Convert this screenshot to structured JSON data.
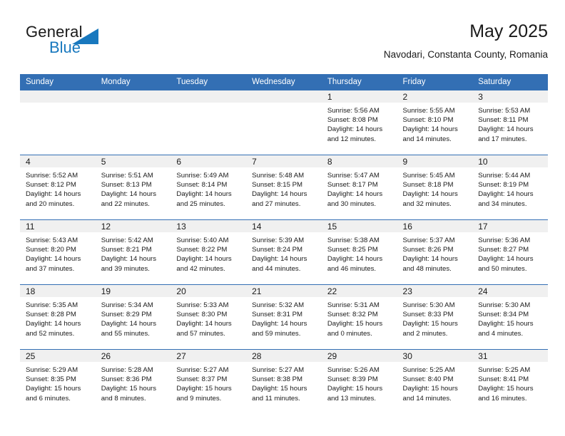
{
  "brand": {
    "name_part1": "General",
    "name_part2": "Blue",
    "triangle_color": "#1878be",
    "icon": "triangle-logo-icon"
  },
  "header": {
    "title": "May 2025",
    "subtitle": "Navodari, Constanta County, Romania",
    "accent_color": "#336fb4",
    "daynum_band_color": "#f0f0f0"
  },
  "weekday_headers": [
    "Sunday",
    "Monday",
    "Tuesday",
    "Wednesday",
    "Thursday",
    "Friday",
    "Saturday"
  ],
  "labels": {
    "sunrise_prefix": "Sunrise:",
    "sunset_prefix": "Sunset:",
    "daylight_prefix": "Daylight:"
  },
  "weeks": [
    [
      {
        "day": "",
        "sunrise": "",
        "sunset": "",
        "daylight_line1": "",
        "daylight_line2": "",
        "empty": true
      },
      {
        "day": "",
        "sunrise": "",
        "sunset": "",
        "daylight_line1": "",
        "daylight_line2": "",
        "empty": true
      },
      {
        "day": "",
        "sunrise": "",
        "sunset": "",
        "daylight_line1": "",
        "daylight_line2": "",
        "empty": true
      },
      {
        "day": "",
        "sunrise": "",
        "sunset": "",
        "daylight_line1": "",
        "daylight_line2": "",
        "empty": true
      },
      {
        "day": "1",
        "sunrise": "Sunrise: 5:56 AM",
        "sunset": "Sunset: 8:08 PM",
        "daylight_line1": "Daylight: 14 hours",
        "daylight_line2": "and 12 minutes.",
        "empty": false
      },
      {
        "day": "2",
        "sunrise": "Sunrise: 5:55 AM",
        "sunset": "Sunset: 8:10 PM",
        "daylight_line1": "Daylight: 14 hours",
        "daylight_line2": "and 14 minutes.",
        "empty": false
      },
      {
        "day": "3",
        "sunrise": "Sunrise: 5:53 AM",
        "sunset": "Sunset: 8:11 PM",
        "daylight_line1": "Daylight: 14 hours",
        "daylight_line2": "and 17 minutes.",
        "empty": false
      }
    ],
    [
      {
        "day": "4",
        "sunrise": "Sunrise: 5:52 AM",
        "sunset": "Sunset: 8:12 PM",
        "daylight_line1": "Daylight: 14 hours",
        "daylight_line2": "and 20 minutes.",
        "empty": false
      },
      {
        "day": "5",
        "sunrise": "Sunrise: 5:51 AM",
        "sunset": "Sunset: 8:13 PM",
        "daylight_line1": "Daylight: 14 hours",
        "daylight_line2": "and 22 minutes.",
        "empty": false
      },
      {
        "day": "6",
        "sunrise": "Sunrise: 5:49 AM",
        "sunset": "Sunset: 8:14 PM",
        "daylight_line1": "Daylight: 14 hours",
        "daylight_line2": "and 25 minutes.",
        "empty": false
      },
      {
        "day": "7",
        "sunrise": "Sunrise: 5:48 AM",
        "sunset": "Sunset: 8:15 PM",
        "daylight_line1": "Daylight: 14 hours",
        "daylight_line2": "and 27 minutes.",
        "empty": false
      },
      {
        "day": "8",
        "sunrise": "Sunrise: 5:47 AM",
        "sunset": "Sunset: 8:17 PM",
        "daylight_line1": "Daylight: 14 hours",
        "daylight_line2": "and 30 minutes.",
        "empty": false
      },
      {
        "day": "9",
        "sunrise": "Sunrise: 5:45 AM",
        "sunset": "Sunset: 8:18 PM",
        "daylight_line1": "Daylight: 14 hours",
        "daylight_line2": "and 32 minutes.",
        "empty": false
      },
      {
        "day": "10",
        "sunrise": "Sunrise: 5:44 AM",
        "sunset": "Sunset: 8:19 PM",
        "daylight_line1": "Daylight: 14 hours",
        "daylight_line2": "and 34 minutes.",
        "empty": false
      }
    ],
    [
      {
        "day": "11",
        "sunrise": "Sunrise: 5:43 AM",
        "sunset": "Sunset: 8:20 PM",
        "daylight_line1": "Daylight: 14 hours",
        "daylight_line2": "and 37 minutes.",
        "empty": false
      },
      {
        "day": "12",
        "sunrise": "Sunrise: 5:42 AM",
        "sunset": "Sunset: 8:21 PM",
        "daylight_line1": "Daylight: 14 hours",
        "daylight_line2": "and 39 minutes.",
        "empty": false
      },
      {
        "day": "13",
        "sunrise": "Sunrise: 5:40 AM",
        "sunset": "Sunset: 8:22 PM",
        "daylight_line1": "Daylight: 14 hours",
        "daylight_line2": "and 42 minutes.",
        "empty": false
      },
      {
        "day": "14",
        "sunrise": "Sunrise: 5:39 AM",
        "sunset": "Sunset: 8:24 PM",
        "daylight_line1": "Daylight: 14 hours",
        "daylight_line2": "and 44 minutes.",
        "empty": false
      },
      {
        "day": "15",
        "sunrise": "Sunrise: 5:38 AM",
        "sunset": "Sunset: 8:25 PM",
        "daylight_line1": "Daylight: 14 hours",
        "daylight_line2": "and 46 minutes.",
        "empty": false
      },
      {
        "day": "16",
        "sunrise": "Sunrise: 5:37 AM",
        "sunset": "Sunset: 8:26 PM",
        "daylight_line1": "Daylight: 14 hours",
        "daylight_line2": "and 48 minutes.",
        "empty": false
      },
      {
        "day": "17",
        "sunrise": "Sunrise: 5:36 AM",
        "sunset": "Sunset: 8:27 PM",
        "daylight_line1": "Daylight: 14 hours",
        "daylight_line2": "and 50 minutes.",
        "empty": false
      }
    ],
    [
      {
        "day": "18",
        "sunrise": "Sunrise: 5:35 AM",
        "sunset": "Sunset: 8:28 PM",
        "daylight_line1": "Daylight: 14 hours",
        "daylight_line2": "and 52 minutes.",
        "empty": false
      },
      {
        "day": "19",
        "sunrise": "Sunrise: 5:34 AM",
        "sunset": "Sunset: 8:29 PM",
        "daylight_line1": "Daylight: 14 hours",
        "daylight_line2": "and 55 minutes.",
        "empty": false
      },
      {
        "day": "20",
        "sunrise": "Sunrise: 5:33 AM",
        "sunset": "Sunset: 8:30 PM",
        "daylight_line1": "Daylight: 14 hours",
        "daylight_line2": "and 57 minutes.",
        "empty": false
      },
      {
        "day": "21",
        "sunrise": "Sunrise: 5:32 AM",
        "sunset": "Sunset: 8:31 PM",
        "daylight_line1": "Daylight: 14 hours",
        "daylight_line2": "and 59 minutes.",
        "empty": false
      },
      {
        "day": "22",
        "sunrise": "Sunrise: 5:31 AM",
        "sunset": "Sunset: 8:32 PM",
        "daylight_line1": "Daylight: 15 hours",
        "daylight_line2": "and 0 minutes.",
        "empty": false
      },
      {
        "day": "23",
        "sunrise": "Sunrise: 5:30 AM",
        "sunset": "Sunset: 8:33 PM",
        "daylight_line1": "Daylight: 15 hours",
        "daylight_line2": "and 2 minutes.",
        "empty": false
      },
      {
        "day": "24",
        "sunrise": "Sunrise: 5:30 AM",
        "sunset": "Sunset: 8:34 PM",
        "daylight_line1": "Daylight: 15 hours",
        "daylight_line2": "and 4 minutes.",
        "empty": false
      }
    ],
    [
      {
        "day": "25",
        "sunrise": "Sunrise: 5:29 AM",
        "sunset": "Sunset: 8:35 PM",
        "daylight_line1": "Daylight: 15 hours",
        "daylight_line2": "and 6 minutes.",
        "empty": false
      },
      {
        "day": "26",
        "sunrise": "Sunrise: 5:28 AM",
        "sunset": "Sunset: 8:36 PM",
        "daylight_line1": "Daylight: 15 hours",
        "daylight_line2": "and 8 minutes.",
        "empty": false
      },
      {
        "day": "27",
        "sunrise": "Sunrise: 5:27 AM",
        "sunset": "Sunset: 8:37 PM",
        "daylight_line1": "Daylight: 15 hours",
        "daylight_line2": "and 9 minutes.",
        "empty": false
      },
      {
        "day": "28",
        "sunrise": "Sunrise: 5:27 AM",
        "sunset": "Sunset: 8:38 PM",
        "daylight_line1": "Daylight: 15 hours",
        "daylight_line2": "and 11 minutes.",
        "empty": false
      },
      {
        "day": "29",
        "sunrise": "Sunrise: 5:26 AM",
        "sunset": "Sunset: 8:39 PM",
        "daylight_line1": "Daylight: 15 hours",
        "daylight_line2": "and 13 minutes.",
        "empty": false
      },
      {
        "day": "30",
        "sunrise": "Sunrise: 5:25 AM",
        "sunset": "Sunset: 8:40 PM",
        "daylight_line1": "Daylight: 15 hours",
        "daylight_line2": "and 14 minutes.",
        "empty": false
      },
      {
        "day": "31",
        "sunrise": "Sunrise: 5:25 AM",
        "sunset": "Sunset: 8:41 PM",
        "daylight_line1": "Daylight: 15 hours",
        "daylight_line2": "and 16 minutes.",
        "empty": false
      }
    ]
  ]
}
